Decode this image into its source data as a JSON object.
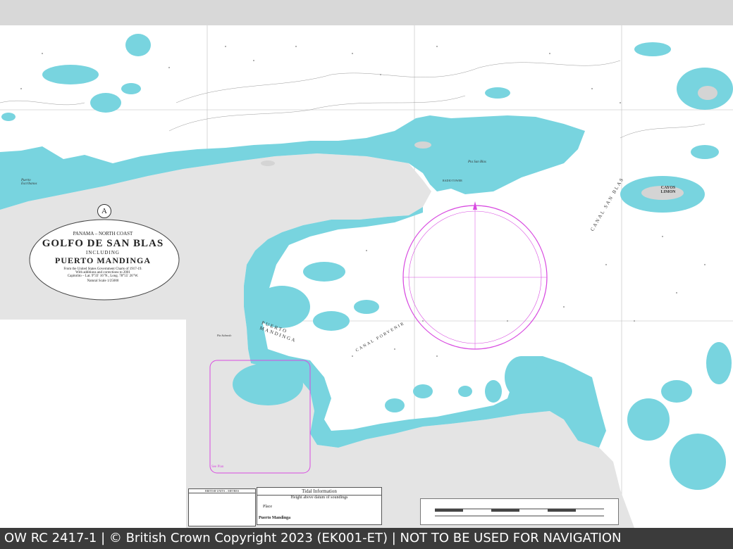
{
  "chart_panel_letter": "A",
  "title_block": {
    "line1": "PANAMA – NORTH COAST",
    "line2": "GOLFO DE SAN BLAS",
    "line3": "INCLUDING",
    "line4": "PUERTO MANDINGA",
    "line5": "From the United States Government Charts of 1917-19.",
    "line6": "With additions and corrections to 2001",
    "line7": "Capitolito – Lat. 9°33′ 16″N., Long. 78°55′ 26″W.",
    "line8": "Natural Scale 1/25000"
  },
  "place_labels": {
    "canal_san_blas": "CANAL SAN BLAS",
    "cayos_limon": "CAYOS LIMON",
    "puerto_mandinga": "PUERTO MANDINGA",
    "canal_porvenir": "CANAL PORVENIR",
    "puerto_escribanos": "Puerto Escribanos",
    "pta_san_blas": "Pta San Blas",
    "radio_tower": "RADIO TOWER",
    "pta_salmedo": "Pta Salmedo",
    "sea_plan": "See Plan"
  },
  "tidal_info": {
    "title": "Tidal Information",
    "subtitle": "Height above datum of soundings",
    "place_header": "Place",
    "place": "Puerto Mandinga"
  },
  "units_table": {
    "title": "BRITISH UNITS – METRES"
  },
  "footer": {
    "text": "OW RC 2417-1 | © British Crown Copyright 2023 (EK001-ET) | NOT TO BE USED FOR NAVIGATION"
  },
  "colors": {
    "shoal": "#78d4df",
    "land": "#e4e4e4",
    "compass": "#d84ae0"
  }
}
